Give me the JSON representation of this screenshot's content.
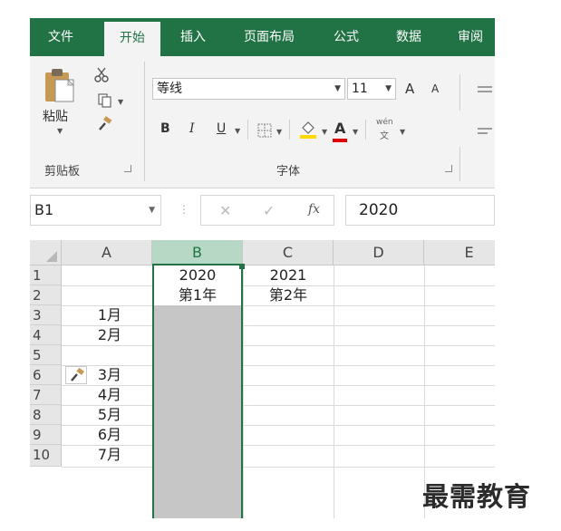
{
  "ribbon_tabs": [
    {
      "label": "文件",
      "active": false
    },
    {
      "label": "开始",
      "active": true
    },
    {
      "label": "插入",
      "active": false
    },
    {
      "label": "页面布局",
      "active": false
    },
    {
      "label": "公式",
      "active": false
    },
    {
      "label": "数据",
      "active": false
    },
    {
      "label": "审阅",
      "active": false
    }
  ],
  "clipboard": {
    "paste_label": "粘贴",
    "group_label": "剪贴板"
  },
  "font": {
    "family": "等线",
    "size": "11",
    "bold": "B",
    "italic": "I",
    "underline": "U",
    "grow": "A",
    "shrink": "A",
    "font_color_glyph": "A",
    "phonetic_glyph": "wén",
    "phonetic_sub": "文",
    "group_label": "字体"
  },
  "formula_bar": {
    "name_box": "B1",
    "cancel_glyph": "✕",
    "enter_glyph": "✓",
    "fx_glyph": "fx",
    "value": "2020"
  },
  "grid": {
    "columns": [
      "A",
      "B",
      "C",
      "D",
      "E"
    ],
    "selected_column": "B",
    "rows": [
      "1",
      "2",
      "3",
      "4",
      "5",
      "6",
      "7",
      "8",
      "9",
      "10"
    ],
    "cells": {
      "B1": "2020",
      "C1": "2021",
      "B2": "第1年",
      "C2": "第2年",
      "A3": "1月",
      "A4": "2月",
      "A6": "3月",
      "A7": "4月",
      "A8": "5月",
      "A9": "6月",
      "A10": "7月"
    }
  },
  "colors": {
    "excel_green": "#217346",
    "selection_fill": "#c6c6c6",
    "header_selected": "#b7d8c4"
  },
  "watermark": "最需教育"
}
